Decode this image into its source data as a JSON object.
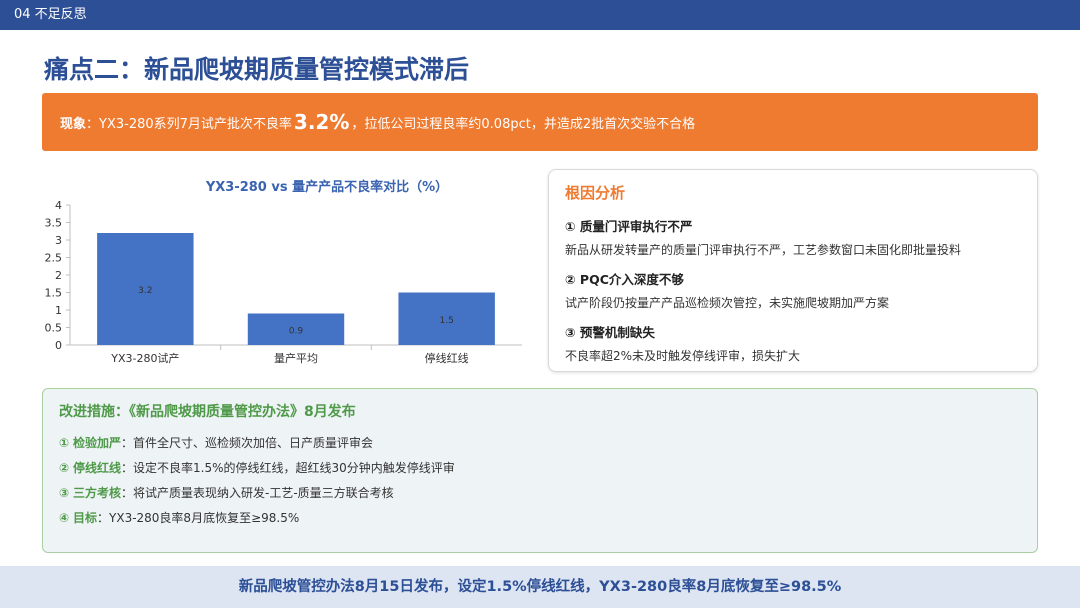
{
  "header": {
    "section": "04 不足反思"
  },
  "title": "痛点二：新品爬坡期质量管控模式滞后",
  "phenomenon": {
    "label": "现象",
    "text_before": "：YX3-280系列7月试产批次不良率",
    "highlight": "3.2%",
    "text_after": "，拉低公司过程良率约0.08pct，并造成2批首次交验不合格"
  },
  "colors": {
    "accent_blue": "#2c4f96",
    "accent_orange": "#ef7b31",
    "accent_green": "#4f9a49",
    "bar_blue": "#4472c4"
  },
  "chart_data": {
    "type": "bar",
    "title": "YX3-280 vs 量产产品不良率对比（%）",
    "categories": [
      "YX3-280试产",
      "量产平均",
      "停线红线"
    ],
    "values": [
      3.2,
      0.9,
      1.5
    ],
    "data_labels": [
      "3.2",
      "0.9",
      "1.5"
    ],
    "ylim": [
      0,
      4
    ],
    "yticks": [
      "0",
      "0.5",
      "1",
      "1.5",
      "2",
      "2.5",
      "3",
      "3.5",
      "4"
    ],
    "grid": false,
    "legend": "none"
  },
  "root_cause": {
    "title": "根因分析",
    "items": [
      {
        "heading": "① 质量门评审执行不严",
        "detail": "新品从研发转量产的质量门评审执行不严，工艺参数窗口未固化即批量投料"
      },
      {
        "heading": "② PQC介入深度不够",
        "detail": "试产阶段仍按量产产品巡检频次管控，未实施爬坡期加严方案"
      },
      {
        "heading": "③ 预警机制缺失",
        "detail": "不良率超2%未及时触发停线评审，损失扩大"
      }
    ]
  },
  "improvement": {
    "title": "改进措施：《新品爬坡期质量管控办法》8月发布",
    "items": [
      {
        "num": "①",
        "key": "检验加严",
        "text": "：首件全尺寸、巡检频次加倍、日产质量评审会"
      },
      {
        "num": "②",
        "key": "停线红线",
        "text": "：设定不良率1.5%的停线红线，超红线30分钟内触发停线评审"
      },
      {
        "num": "③",
        "key": "三方考核",
        "text": "：将试产质量表现纳入研发-工艺-质量三方联合考核"
      },
      {
        "num": "④",
        "key": "目标",
        "text": "：YX3-280良率8月底恢复至≥98.5%"
      }
    ]
  },
  "footer": {
    "text": "新品爬坡管控办法8月15日发布，设定1.5%停线红线，YX3-280良率8月底恢复至≥98.5%"
  }
}
